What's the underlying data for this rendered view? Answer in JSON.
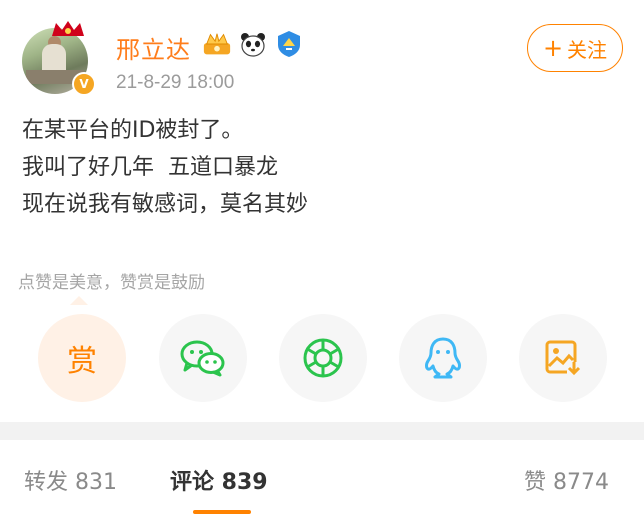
{
  "post": {
    "author": "邢立达",
    "timestamp": "21-8-29 18:00",
    "follow_label": "关注",
    "follow_plus": "+",
    "vip_letter": "V",
    "lines": [
      "在某平台的ID被封了。",
      "我叫了好几年  五道口暴龙",
      "现在说我有敏感词，莫名其妙"
    ],
    "reward_tip": "点赞是美意，赞赏是鼓励",
    "reward_glyph": "赏"
  },
  "share_icons": [
    "reward-icon",
    "wechat-icon",
    "moments-icon",
    "qq-icon",
    "save-image-icon"
  ],
  "stats": {
    "repost_label": "转发 831",
    "comment_label": "评论 839",
    "like_label": "赞 8774"
  },
  "colors": {
    "accent": "#ff8200",
    "name": "#ff7d1b",
    "wechat": "#2bc44d",
    "qq": "#3fb8f5",
    "save": "#f5a623"
  }
}
